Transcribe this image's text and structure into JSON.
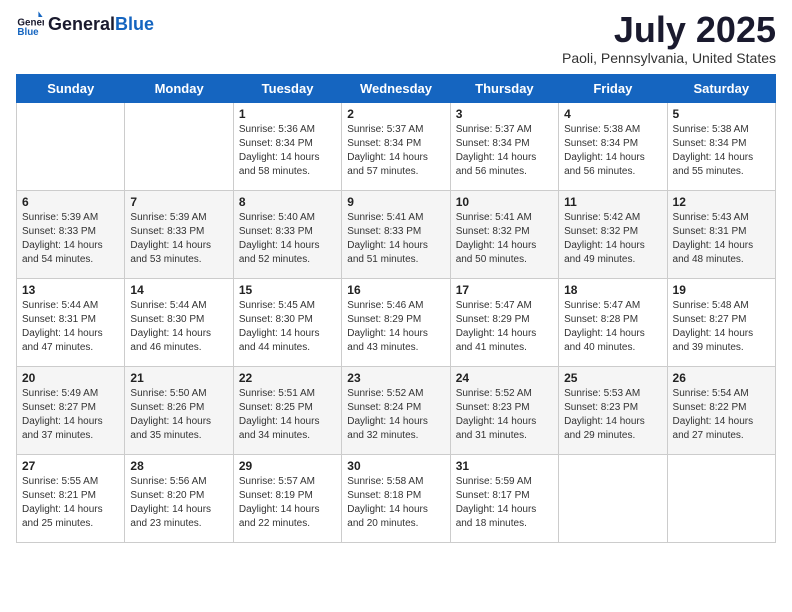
{
  "logo": {
    "general": "General",
    "blue": "Blue"
  },
  "title": "July 2025",
  "subtitle": "Paoli, Pennsylvania, United States",
  "days_of_week": [
    "Sunday",
    "Monday",
    "Tuesday",
    "Wednesday",
    "Thursday",
    "Friday",
    "Saturday"
  ],
  "weeks": [
    [
      {
        "day": "",
        "info": ""
      },
      {
        "day": "",
        "info": ""
      },
      {
        "day": "1",
        "info": "Sunrise: 5:36 AM\nSunset: 8:34 PM\nDaylight: 14 hours and 58 minutes."
      },
      {
        "day": "2",
        "info": "Sunrise: 5:37 AM\nSunset: 8:34 PM\nDaylight: 14 hours and 57 minutes."
      },
      {
        "day": "3",
        "info": "Sunrise: 5:37 AM\nSunset: 8:34 PM\nDaylight: 14 hours and 56 minutes."
      },
      {
        "day": "4",
        "info": "Sunrise: 5:38 AM\nSunset: 8:34 PM\nDaylight: 14 hours and 56 minutes."
      },
      {
        "day": "5",
        "info": "Sunrise: 5:38 AM\nSunset: 8:34 PM\nDaylight: 14 hours and 55 minutes."
      }
    ],
    [
      {
        "day": "6",
        "info": "Sunrise: 5:39 AM\nSunset: 8:33 PM\nDaylight: 14 hours and 54 minutes."
      },
      {
        "day": "7",
        "info": "Sunrise: 5:39 AM\nSunset: 8:33 PM\nDaylight: 14 hours and 53 minutes."
      },
      {
        "day": "8",
        "info": "Sunrise: 5:40 AM\nSunset: 8:33 PM\nDaylight: 14 hours and 52 minutes."
      },
      {
        "day": "9",
        "info": "Sunrise: 5:41 AM\nSunset: 8:33 PM\nDaylight: 14 hours and 51 minutes."
      },
      {
        "day": "10",
        "info": "Sunrise: 5:41 AM\nSunset: 8:32 PM\nDaylight: 14 hours and 50 minutes."
      },
      {
        "day": "11",
        "info": "Sunrise: 5:42 AM\nSunset: 8:32 PM\nDaylight: 14 hours and 49 minutes."
      },
      {
        "day": "12",
        "info": "Sunrise: 5:43 AM\nSunset: 8:31 PM\nDaylight: 14 hours and 48 minutes."
      }
    ],
    [
      {
        "day": "13",
        "info": "Sunrise: 5:44 AM\nSunset: 8:31 PM\nDaylight: 14 hours and 47 minutes."
      },
      {
        "day": "14",
        "info": "Sunrise: 5:44 AM\nSunset: 8:30 PM\nDaylight: 14 hours and 46 minutes."
      },
      {
        "day": "15",
        "info": "Sunrise: 5:45 AM\nSunset: 8:30 PM\nDaylight: 14 hours and 44 minutes."
      },
      {
        "day": "16",
        "info": "Sunrise: 5:46 AM\nSunset: 8:29 PM\nDaylight: 14 hours and 43 minutes."
      },
      {
        "day": "17",
        "info": "Sunrise: 5:47 AM\nSunset: 8:29 PM\nDaylight: 14 hours and 41 minutes."
      },
      {
        "day": "18",
        "info": "Sunrise: 5:47 AM\nSunset: 8:28 PM\nDaylight: 14 hours and 40 minutes."
      },
      {
        "day": "19",
        "info": "Sunrise: 5:48 AM\nSunset: 8:27 PM\nDaylight: 14 hours and 39 minutes."
      }
    ],
    [
      {
        "day": "20",
        "info": "Sunrise: 5:49 AM\nSunset: 8:27 PM\nDaylight: 14 hours and 37 minutes."
      },
      {
        "day": "21",
        "info": "Sunrise: 5:50 AM\nSunset: 8:26 PM\nDaylight: 14 hours and 35 minutes."
      },
      {
        "day": "22",
        "info": "Sunrise: 5:51 AM\nSunset: 8:25 PM\nDaylight: 14 hours and 34 minutes."
      },
      {
        "day": "23",
        "info": "Sunrise: 5:52 AM\nSunset: 8:24 PM\nDaylight: 14 hours and 32 minutes."
      },
      {
        "day": "24",
        "info": "Sunrise: 5:52 AM\nSunset: 8:23 PM\nDaylight: 14 hours and 31 minutes."
      },
      {
        "day": "25",
        "info": "Sunrise: 5:53 AM\nSunset: 8:23 PM\nDaylight: 14 hours and 29 minutes."
      },
      {
        "day": "26",
        "info": "Sunrise: 5:54 AM\nSunset: 8:22 PM\nDaylight: 14 hours and 27 minutes."
      }
    ],
    [
      {
        "day": "27",
        "info": "Sunrise: 5:55 AM\nSunset: 8:21 PM\nDaylight: 14 hours and 25 minutes."
      },
      {
        "day": "28",
        "info": "Sunrise: 5:56 AM\nSunset: 8:20 PM\nDaylight: 14 hours and 23 minutes."
      },
      {
        "day": "29",
        "info": "Sunrise: 5:57 AM\nSunset: 8:19 PM\nDaylight: 14 hours and 22 minutes."
      },
      {
        "day": "30",
        "info": "Sunrise: 5:58 AM\nSunset: 8:18 PM\nDaylight: 14 hours and 20 minutes."
      },
      {
        "day": "31",
        "info": "Sunrise: 5:59 AM\nSunset: 8:17 PM\nDaylight: 14 hours and 18 minutes."
      },
      {
        "day": "",
        "info": ""
      },
      {
        "day": "",
        "info": ""
      }
    ]
  ]
}
